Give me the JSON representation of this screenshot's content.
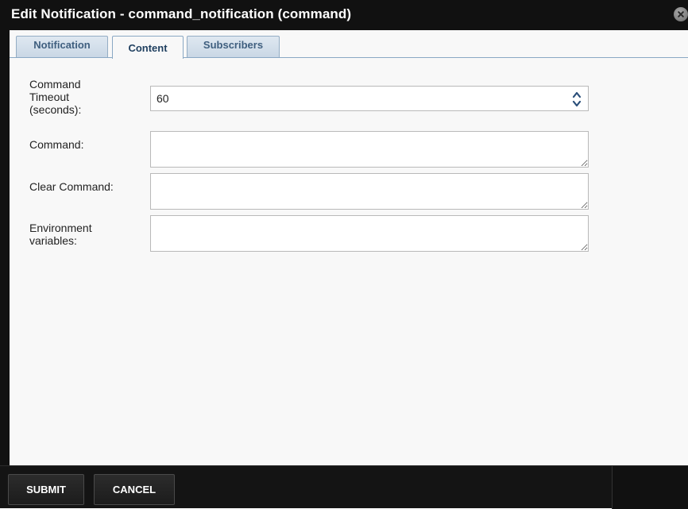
{
  "dialog": {
    "title": "Edit Notification - command_notification (command)",
    "close_icon": "close-icon"
  },
  "tabs": [
    {
      "label": "Notification",
      "active": false
    },
    {
      "label": "Content",
      "active": true
    },
    {
      "label": "Subscribers",
      "active": false
    }
  ],
  "form": {
    "timeout": {
      "label_line1": "Command",
      "label_line2": "Timeout",
      "label_line3": "(seconds):",
      "value": "60",
      "up_icon": "chevron-up-icon",
      "down_icon": "chevron-down-icon"
    },
    "command": {
      "label": "Command:",
      "value": ""
    },
    "clear_command": {
      "label": "Clear Command:",
      "value": ""
    },
    "environment": {
      "label_line1": "Environment",
      "label_line2": "variables:",
      "value": ""
    }
  },
  "footer": {
    "submit_label": "SUBMIT",
    "cancel_label": "CANCEL"
  },
  "colors": {
    "titlebar_bg": "#111111",
    "content_bg": "#f8f8f8",
    "tab_text": "#3f5f7f",
    "tab_border": "#94adc4",
    "footer_bg": "#141414"
  }
}
